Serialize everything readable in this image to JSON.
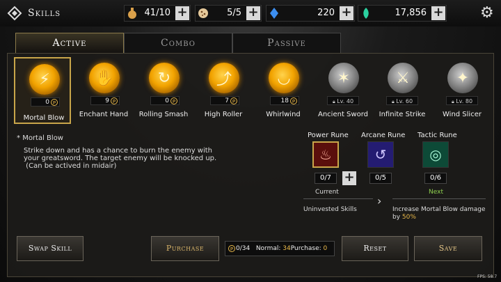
{
  "header": {
    "title": "Skills",
    "resources": [
      {
        "icon": "stamina-potion-icon",
        "value": "41/10"
      },
      {
        "icon": "cookie-icon",
        "value": "5/5"
      },
      {
        "icon": "blue-crystal-icon",
        "value": "220"
      },
      {
        "icon": "green-gem-icon",
        "value": "17,856"
      }
    ]
  },
  "tabs": [
    {
      "label": "Active",
      "active": true
    },
    {
      "label": "Combo",
      "active": false
    },
    {
      "label": "Passive",
      "active": false
    }
  ],
  "point_symbol": "P",
  "skills": [
    {
      "name": "Mortal Blow",
      "cost": "0",
      "locked": false,
      "selected": true,
      "glyph": "⚡"
    },
    {
      "name": "Enchant Hand",
      "cost": "9",
      "locked": false,
      "selected": false,
      "glyph": "✋"
    },
    {
      "name": "Rolling Smash",
      "cost": "0",
      "locked": false,
      "selected": false,
      "glyph": "↻"
    },
    {
      "name": "High Roller",
      "cost": "7",
      "locked": false,
      "selected": false,
      "glyph": "⤴"
    },
    {
      "name": "Whirlwind",
      "cost": "18",
      "locked": false,
      "selected": false,
      "glyph": "◡"
    },
    {
      "name": "Ancient Sword",
      "level": "Lv. 40",
      "locked": true,
      "selected": false,
      "glyph": "✶"
    },
    {
      "name": "Infinite Strike",
      "level": "Lv. 60",
      "locked": true,
      "selected": false,
      "glyph": "⚔"
    },
    {
      "name": "Wind Slicer",
      "level": "Lv. 80",
      "locked": true,
      "selected": false,
      "glyph": "✦"
    }
  ],
  "detail": {
    "skill_name": "Mortal Blow",
    "bullet": "*",
    "description": "Strike down and has a chance to burn the enemy with\nyour greatsword. The target enemy will be knocked up.\n (Can be actived in midair)"
  },
  "runes": [
    {
      "label": "Power Rune",
      "count": "0/7",
      "color": "#b0231b",
      "glyph": "♨"
    },
    {
      "label": "Arcane Rune",
      "count": "0/5",
      "color": "#3b2fb0",
      "glyph": "↺"
    },
    {
      "label": "Tactic Rune",
      "count": "0/6",
      "color": "#1a7a5a",
      "glyph": "◎"
    }
  ],
  "rune_status": {
    "current": "Current",
    "next": "Next",
    "current_text": "Uninvested Skills",
    "arrow": "›",
    "next_text_1": "Increase Mortal Blow damage",
    "next_text_2": "by",
    "next_value": "50%"
  },
  "buttons": {
    "swap": "Swap Skill",
    "purchase": "Purchase",
    "reset": "Reset",
    "save": "Save"
  },
  "points": {
    "available": "0/34",
    "normal_label": "Normal:",
    "normal_value": "34",
    "purchase_label": "Purchase:",
    "purchase_value": "0"
  },
  "fps": "FPS: 58.7",
  "colors": {
    "gold": "#e8b84a",
    "next_green": "#8fd14f",
    "selected_border": "#c9a64a"
  }
}
